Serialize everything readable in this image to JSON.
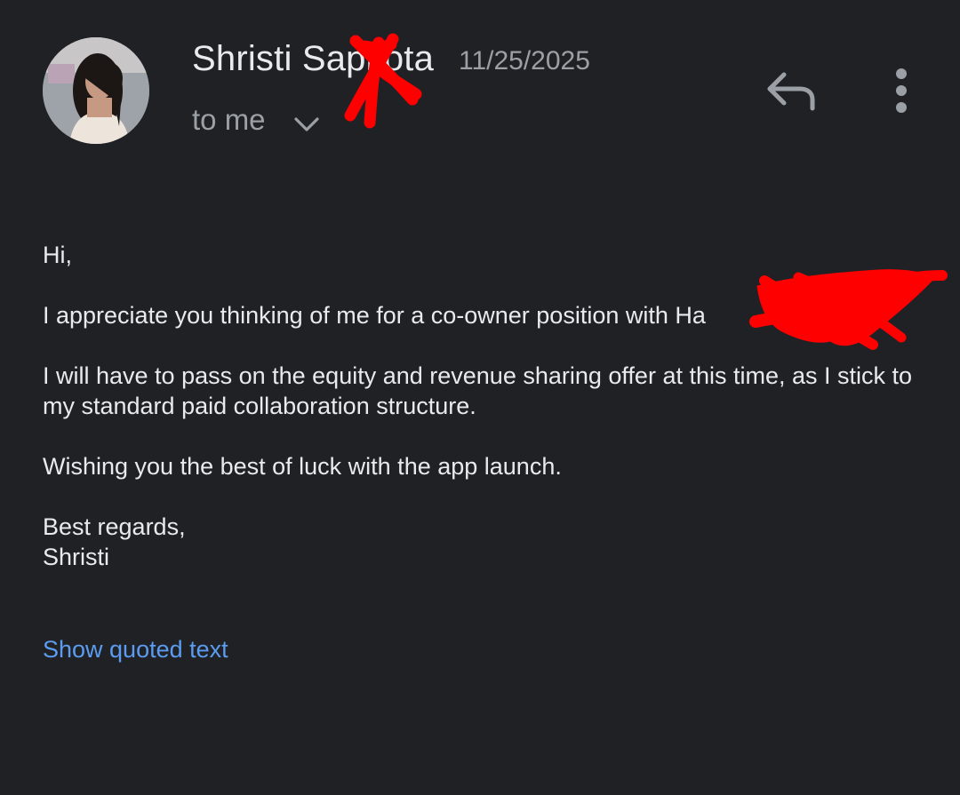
{
  "header": {
    "sender_name": "Shristi Sapkota",
    "date": "11/25/2025",
    "recipient_label": "to me",
    "avatar_icon": "avatar-photo",
    "reply_icon": "reply-icon",
    "more_icon": "more-vert-icon",
    "expand_icon": "chevron-down-icon"
  },
  "message": {
    "greeting": "Hi,",
    "paragraph_1": "I appreciate you thinking of me for a co-owner position with Ha",
    "paragraph_2": "I will have to pass on the equity and revenue sharing offer at this time, as I stick to my standard paid collaboration structure.",
    "paragraph_3": "Wishing you the best of luck with the app launch.",
    "closing": "Best regards,",
    "signature": "Shristi"
  },
  "actions": {
    "show_quoted_text": "Show quoted text"
  },
  "colors": {
    "background": "#202124",
    "primary_text": "#e8eaed",
    "secondary_text": "#9aa0a6",
    "link": "#5b9cf0",
    "redaction": "#ff0000"
  }
}
